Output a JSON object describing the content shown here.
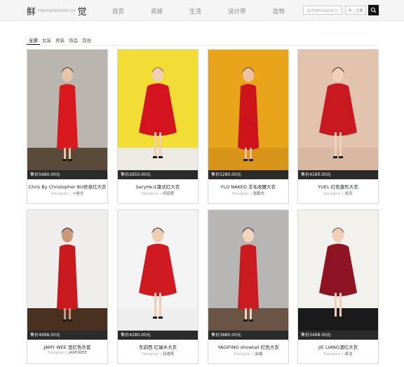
{
  "header": {
    "logo_left": "鲜",
    "logo_sub": "FRESHDESIGN.CN",
    "logo_right": "觉",
    "nav": [
      "首页",
      "商城",
      "生活",
      "设计师",
      "造物"
    ],
    "message_label": "站内MESSAGE(0)",
    "lang_label": "中 | 注册",
    "search_icon": "search-icon"
  },
  "tabs": [
    "全部",
    "女装",
    "男装",
    "饰品",
    "其他"
  ],
  "active_tab": 0,
  "designer_label": "Designer",
  "products": [
    {
      "price": "售价5680.00元",
      "title": "Chris By Christopher BU修身红大衣",
      "designer": "卜桂文",
      "colors": {
        "bg": "#b9b6b0",
        "floor": "#5a4a3a",
        "coat": "#d8191e",
        "skin": "#e8c4a8",
        "hair": "#3b2a1f"
      }
    },
    {
      "price": "售价2650.00元",
      "title": "SaryHe斗篷式红大衣",
      "designer": "何佳昵",
      "colors": {
        "bg": "#f1dd35",
        "floor": "#ede9e3",
        "coat": "#d3141c",
        "skin": "#f0cfb5",
        "hair": "#8a5a2e"
      }
    },
    {
      "price": "售价5280.00元",
      "title": "FLO NAKED 羊毛收腰大衣",
      "designer": "张勤文",
      "colors": {
        "bg": "#e8a51c",
        "floor": "#d9951a",
        "coat": "#cc141a",
        "skin": "#eec2a0",
        "hair": "#5a3a20"
      }
    },
    {
      "price": "售价4160.00元",
      "title": "YUEL 红色茧形大衣",
      "designer": "尚月",
      "colors": {
        "bg": "#e2c3ae",
        "floor": "#d9b8a2",
        "coat": "#c81820",
        "skin": "#f0d0b8",
        "hair": "#2a1a12"
      }
    },
    {
      "price": "售价4998.00元",
      "title": "JAMY WEE 宽红色外套",
      "designer": "JAMYWEE",
      "colors": {
        "bg": "#efeeec",
        "floor": "#4a3020",
        "coat": "#c81a1e",
        "skin": "#c99878",
        "hair": "#1e1410"
      }
    },
    {
      "price": "售价4280.00元",
      "title": "东韵西 红瑞木大衣",
      "designer": "邱迪阵",
      "colors": {
        "bg": "#f4f4f4",
        "floor": "#eeeeee",
        "coat": "#cf1a22",
        "skin": "#efcdb3",
        "hair": "#1e1410"
      }
    },
    {
      "price": "售价3880.00元",
      "title": "YAGIFINO showtail 红色大衣",
      "designer": "启霖",
      "colors": {
        "bg": "#b8b6b4",
        "floor": "#6a5446",
        "coat": "#c91b20",
        "skin": "#f1d3c0",
        "hair": "#1a1210"
      }
    },
    {
      "price": "售价3498.00元",
      "title": "JIE LIANG酒红大衣",
      "designer": "梁洁",
      "colors": {
        "bg": "#f3f1ee",
        "floor": "#1a1a1a",
        "coat": "#8e1323",
        "skin": "#efcfb8",
        "hair": "#5a3a22"
      }
    }
  ]
}
